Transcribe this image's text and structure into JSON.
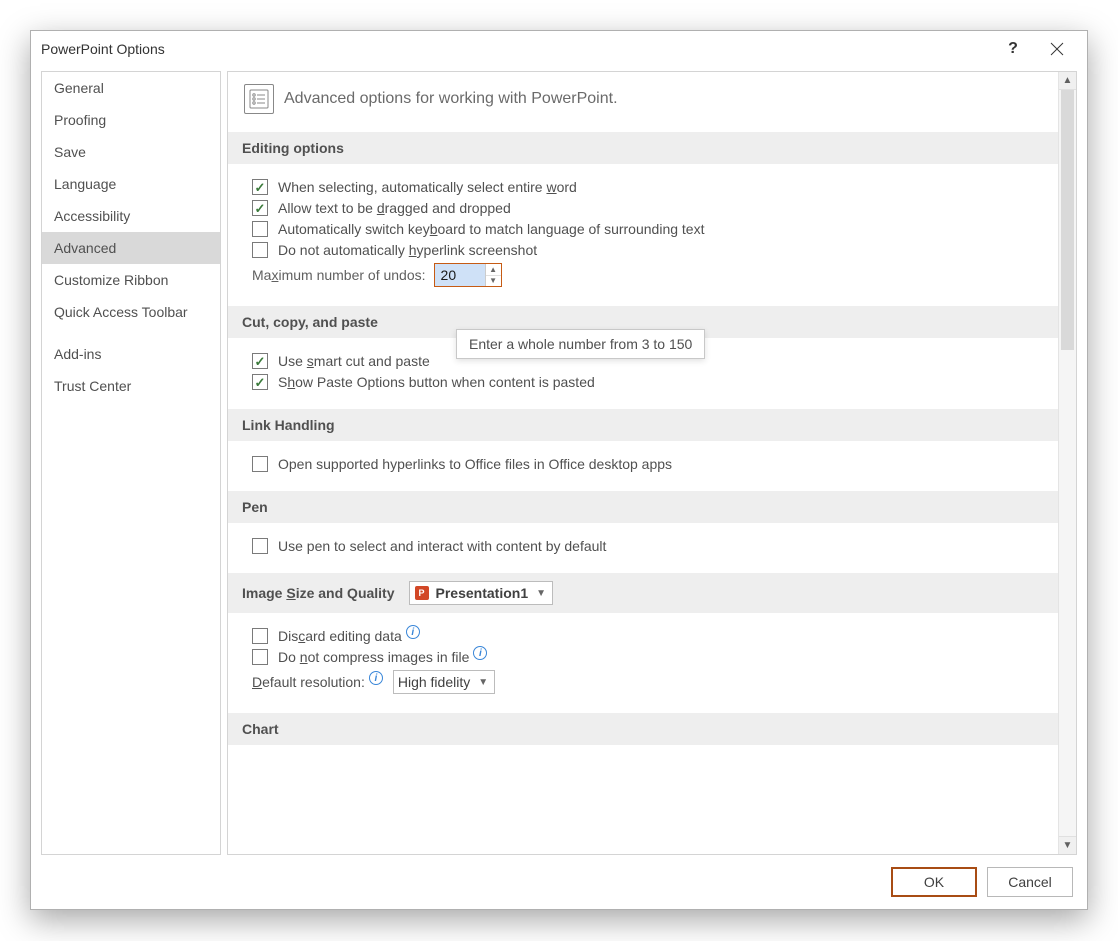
{
  "title": "PowerPoint Options",
  "sidebar": {
    "items": [
      {
        "label": "General"
      },
      {
        "label": "Proofing"
      },
      {
        "label": "Save"
      },
      {
        "label": "Language"
      },
      {
        "label": "Accessibility"
      },
      {
        "label": "Advanced"
      },
      {
        "label": "Customize Ribbon"
      },
      {
        "label": "Quick Access Toolbar"
      },
      {
        "label": "Add-ins"
      },
      {
        "label": "Trust Center"
      }
    ],
    "selected": 5
  },
  "header": "Advanced options for working with PowerPoint.",
  "sections": {
    "editing": {
      "title": "Editing options",
      "opt_select_word_pre": "When selecting, automatically select entire ",
      "opt_select_word_u": "w",
      "opt_select_word_post": "ord",
      "opt_drag_pre": "Allow text to be ",
      "opt_drag_u": "d",
      "opt_drag_post": "ragged and dropped",
      "opt_keyboard_pre": "Automatically switch key",
      "opt_keyboard_u": "b",
      "opt_keyboard_post": "oard to match language of surrounding text",
      "opt_hyperlink_pre": "Do not automatically ",
      "opt_hyperlink_u": "h",
      "opt_hyperlink_post": "yperlink screenshot",
      "undo_label_pre": "Ma",
      "undo_label_u": "x",
      "undo_label_post": "imum number of undos:",
      "undo_value": "20",
      "undo_tooltip": "Enter a whole number from 3 to 150"
    },
    "ccp": {
      "title": "Cut, copy, and paste",
      "opt_smart_pre": "Use ",
      "opt_smart_u": "s",
      "opt_smart_post": "mart cut and paste",
      "opt_paste_pre": "S",
      "opt_paste_u": "h",
      "opt_paste_post": "ow Paste Options button when content is pasted"
    },
    "link": {
      "title": "Link Handling",
      "opt_open": "Open supported hyperlinks to Office files in Office desktop apps"
    },
    "pen": {
      "title": "Pen",
      "opt_pen": "Use pen to select and interact with content by default"
    },
    "img": {
      "title_pre": "Image ",
      "title_u": "S",
      "title_post": "ize and Quality",
      "dropdown": "Presentation1",
      "opt_discard_pre": "Dis",
      "opt_discard_u": "c",
      "opt_discard_post": "ard editing data",
      "opt_nocompress_pre": "Do ",
      "opt_nocompress_u": "n",
      "opt_nocompress_post": "ot compress images in file",
      "res_label_pre": "",
      "res_label_u": "D",
      "res_label_post": "efault resolution:",
      "res_value": "High fidelity"
    },
    "chart": {
      "title": "Chart"
    }
  },
  "footer": {
    "ok": "OK",
    "cancel": "Cancel"
  }
}
